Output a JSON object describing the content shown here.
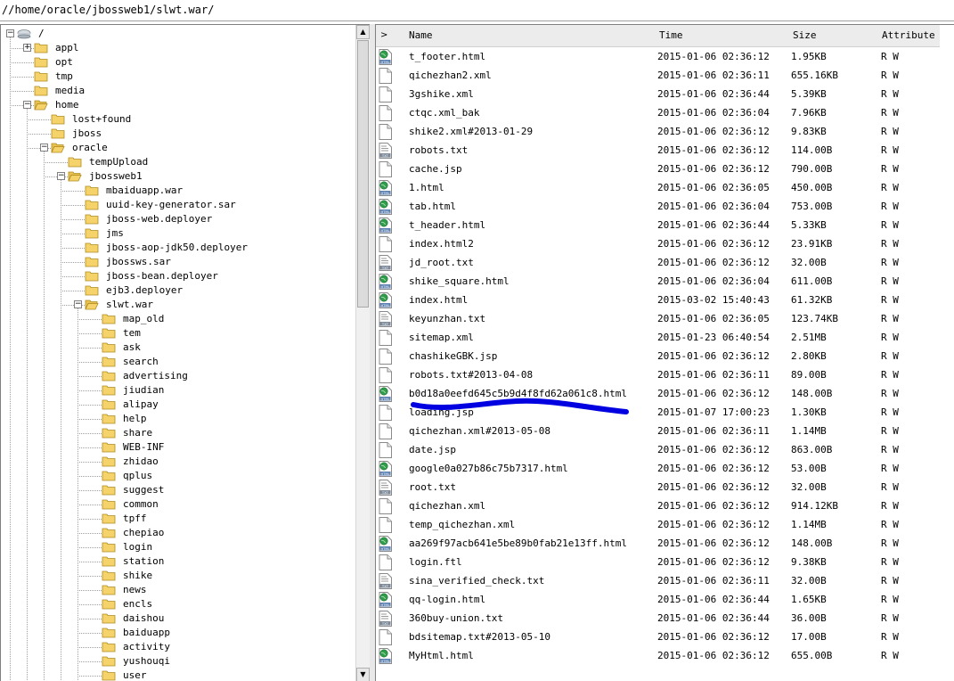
{
  "path": "//home/oracle/jbossweb1/slwt.war/",
  "tree": {
    "nodes": [
      {
        "label": "/",
        "depth": 0,
        "exp": "minus",
        "icon": "drive-icon"
      },
      {
        "label": "appl",
        "depth": 1,
        "exp": "plus",
        "icon": "folder-icon"
      },
      {
        "label": "opt",
        "depth": 1,
        "exp": "",
        "icon": "folder-icon"
      },
      {
        "label": "tmp",
        "depth": 1,
        "exp": "",
        "icon": "folder-icon"
      },
      {
        "label": "media",
        "depth": 1,
        "exp": "",
        "icon": "folder-icon"
      },
      {
        "label": "home",
        "depth": 1,
        "exp": "minus",
        "icon": "folder-open-icon"
      },
      {
        "label": "lost+found",
        "depth": 2,
        "exp": "",
        "icon": "folder-icon"
      },
      {
        "label": "jboss",
        "depth": 2,
        "exp": "",
        "icon": "folder-icon"
      },
      {
        "label": "oracle",
        "depth": 2,
        "exp": "minus",
        "icon": "folder-open-icon"
      },
      {
        "label": "tempUpload",
        "depth": 3,
        "exp": "",
        "icon": "folder-icon"
      },
      {
        "label": "jbossweb1",
        "depth": 3,
        "exp": "minus",
        "icon": "folder-open-icon"
      },
      {
        "label": "mbaiduapp.war",
        "depth": 4,
        "exp": "",
        "icon": "folder-icon"
      },
      {
        "label": "uuid-key-generator.sar",
        "depth": 4,
        "exp": "",
        "icon": "folder-icon"
      },
      {
        "label": "jboss-web.deployer",
        "depth": 4,
        "exp": "",
        "icon": "folder-icon"
      },
      {
        "label": "jms",
        "depth": 4,
        "exp": "",
        "icon": "folder-icon"
      },
      {
        "label": "jboss-aop-jdk50.deployer",
        "depth": 4,
        "exp": "",
        "icon": "folder-icon"
      },
      {
        "label": "jbossws.sar",
        "depth": 4,
        "exp": "",
        "icon": "folder-icon"
      },
      {
        "label": "jboss-bean.deployer",
        "depth": 4,
        "exp": "",
        "icon": "folder-icon"
      },
      {
        "label": "ejb3.deployer",
        "depth": 4,
        "exp": "",
        "icon": "folder-icon"
      },
      {
        "label": "slwt.war",
        "depth": 4,
        "exp": "minus",
        "icon": "folder-open-icon"
      },
      {
        "label": "map_old",
        "depth": 5,
        "exp": "",
        "icon": "folder-icon"
      },
      {
        "label": "tem",
        "depth": 5,
        "exp": "",
        "icon": "folder-icon"
      },
      {
        "label": "ask",
        "depth": 5,
        "exp": "",
        "icon": "folder-icon"
      },
      {
        "label": "search",
        "depth": 5,
        "exp": "",
        "icon": "folder-icon"
      },
      {
        "label": "advertising",
        "depth": 5,
        "exp": "",
        "icon": "folder-icon"
      },
      {
        "label": "jiudian",
        "depth": 5,
        "exp": "",
        "icon": "folder-icon"
      },
      {
        "label": "alipay",
        "depth": 5,
        "exp": "",
        "icon": "folder-icon"
      },
      {
        "label": "help",
        "depth": 5,
        "exp": "",
        "icon": "folder-icon"
      },
      {
        "label": "share",
        "depth": 5,
        "exp": "",
        "icon": "folder-icon"
      },
      {
        "label": "WEB-INF",
        "depth": 5,
        "exp": "",
        "icon": "folder-icon"
      },
      {
        "label": "zhidao",
        "depth": 5,
        "exp": "",
        "icon": "folder-icon"
      },
      {
        "label": "qplus",
        "depth": 5,
        "exp": "",
        "icon": "folder-icon"
      },
      {
        "label": "suggest",
        "depth": 5,
        "exp": "",
        "icon": "folder-icon"
      },
      {
        "label": "common",
        "depth": 5,
        "exp": "",
        "icon": "folder-icon"
      },
      {
        "label": "tpff",
        "depth": 5,
        "exp": "",
        "icon": "folder-icon"
      },
      {
        "label": "chepiao",
        "depth": 5,
        "exp": "",
        "icon": "folder-icon"
      },
      {
        "label": "login",
        "depth": 5,
        "exp": "",
        "icon": "folder-icon"
      },
      {
        "label": "station",
        "depth": 5,
        "exp": "",
        "icon": "folder-icon"
      },
      {
        "label": "shike",
        "depth": 5,
        "exp": "",
        "icon": "folder-icon"
      },
      {
        "label": "news",
        "depth": 5,
        "exp": "",
        "icon": "folder-icon"
      },
      {
        "label": "encls",
        "depth": 5,
        "exp": "",
        "icon": "folder-icon"
      },
      {
        "label": "daishou",
        "depth": 5,
        "exp": "",
        "icon": "folder-icon"
      },
      {
        "label": "baiduapp",
        "depth": 5,
        "exp": "",
        "icon": "folder-icon"
      },
      {
        "label": "activity",
        "depth": 5,
        "exp": "",
        "icon": "folder-icon"
      },
      {
        "label": "yushouqi",
        "depth": 5,
        "exp": "",
        "icon": "folder-icon"
      },
      {
        "label": "user",
        "depth": 5,
        "exp": "",
        "icon": "folder-icon"
      }
    ]
  },
  "list": {
    "header_icon": "chevron-right-icon",
    "columns": {
      "name": "Name",
      "time": "Time",
      "size": "Size",
      "attr": "Attribute"
    },
    "files": [
      {
        "name": "t_footer.html",
        "time": "2015-01-06 02:36:12",
        "size": "1.95KB",
        "attr": "R W",
        "icon": "html-file-icon"
      },
      {
        "name": "qichezhan2.xml",
        "time": "2015-01-06 02:36:11",
        "size": "655.16KB",
        "attr": "R W",
        "icon": "file-icon"
      },
      {
        "name": "3gshike.xml",
        "time": "2015-01-06 02:36:44",
        "size": "5.39KB",
        "attr": "R W",
        "icon": "file-icon"
      },
      {
        "name": "ctqc.xml_bak",
        "time": "2015-01-06 02:36:04",
        "size": "7.96KB",
        "attr": "R W",
        "icon": "file-icon"
      },
      {
        "name": "shike2.xml#2013-01-29",
        "time": "2015-01-06 02:36:12",
        "size": "9.83KB",
        "attr": "R W",
        "icon": "file-icon"
      },
      {
        "name": "robots.txt",
        "time": "2015-01-06 02:36:12",
        "size": "114.00B",
        "attr": "R W",
        "icon": "txt-file-icon"
      },
      {
        "name": "cache.jsp",
        "time": "2015-01-06 02:36:12",
        "size": "790.00B",
        "attr": "R W",
        "icon": "file-icon"
      },
      {
        "name": "1.html",
        "time": "2015-01-06 02:36:05",
        "size": "450.00B",
        "attr": "R W",
        "icon": "html-file-icon"
      },
      {
        "name": "tab.html",
        "time": "2015-01-06 02:36:04",
        "size": "753.00B",
        "attr": "R W",
        "icon": "html-file-icon"
      },
      {
        "name": "t_header.html",
        "time": "2015-01-06 02:36:44",
        "size": "5.33KB",
        "attr": "R W",
        "icon": "html-file-icon"
      },
      {
        "name": "index.html2",
        "time": "2015-01-06 02:36:12",
        "size": "23.91KB",
        "attr": "R W",
        "icon": "file-icon"
      },
      {
        "name": "jd_root.txt",
        "time": "2015-01-06 02:36:12",
        "size": "32.00B",
        "attr": "R W",
        "icon": "txt-file-icon"
      },
      {
        "name": "shike_square.html",
        "time": "2015-01-06 02:36:04",
        "size": "611.00B",
        "attr": "R W",
        "icon": "html-file-icon"
      },
      {
        "name": "index.html",
        "time": "2015-03-02 15:40:43",
        "size": "61.32KB",
        "attr": "R W",
        "icon": "html-file-icon"
      },
      {
        "name": "keyunzhan.txt",
        "time": "2015-01-06 02:36:05",
        "size": "123.74KB",
        "attr": "R W",
        "icon": "txt-file-icon"
      },
      {
        "name": "sitemap.xml",
        "time": "2015-01-23 06:40:54",
        "size": "2.51MB",
        "attr": "R W",
        "icon": "file-icon"
      },
      {
        "name": "chashikeGBK.jsp",
        "time": "2015-01-06 02:36:12",
        "size": "2.80KB",
        "attr": "R W",
        "icon": "file-icon"
      },
      {
        "name": "robots.txt#2013-04-08",
        "time": "2015-01-06 02:36:11",
        "size": "89.00B",
        "attr": "R W",
        "icon": "file-icon"
      },
      {
        "name": "b0d18a0eefd645c5b9d4f8fd62a061c8.html",
        "time": "2015-01-06 02:36:12",
        "size": "148.00B",
        "attr": "R W",
        "icon": "html-file-icon"
      },
      {
        "name": "loading.jsp",
        "time": "2015-01-07 17:00:23",
        "size": "1.30KB",
        "attr": "R W",
        "icon": "file-icon"
      },
      {
        "name": "qichezhan.xml#2013-05-08",
        "time": "2015-01-06 02:36:11",
        "size": "1.14MB",
        "attr": "R W",
        "icon": "file-icon"
      },
      {
        "name": "date.jsp",
        "time": "2015-01-06 02:36:12",
        "size": "863.00B",
        "attr": "R W",
        "icon": "file-icon"
      },
      {
        "name": "google0a027b86c75b7317.html",
        "time": "2015-01-06 02:36:12",
        "size": "53.00B",
        "attr": "R W",
        "icon": "html-file-icon"
      },
      {
        "name": "root.txt",
        "time": "2015-01-06 02:36:12",
        "size": "32.00B",
        "attr": "R W",
        "icon": "txt-file-icon"
      },
      {
        "name": "qichezhan.xml",
        "time": "2015-01-06 02:36:12",
        "size": "914.12KB",
        "attr": "R W",
        "icon": "file-icon"
      },
      {
        "name": "temp_qichezhan.xml",
        "time": "2015-01-06 02:36:12",
        "size": "1.14MB",
        "attr": "R W",
        "icon": "file-icon"
      },
      {
        "name": "aa269f97acb641e5be89b0fab21e13ff.html",
        "time": "2015-01-06 02:36:12",
        "size": "148.00B",
        "attr": "R W",
        "icon": "html-file-icon"
      },
      {
        "name": "login.ftl",
        "time": "2015-01-06 02:36:12",
        "size": "9.38KB",
        "attr": "R W",
        "icon": "file-icon"
      },
      {
        "name": "sina_verified_check.txt",
        "time": "2015-01-06 02:36:11",
        "size": "32.00B",
        "attr": "R W",
        "icon": "txt-file-icon"
      },
      {
        "name": "qq-login.html",
        "time": "2015-01-06 02:36:44",
        "size": "1.65KB",
        "attr": "R W",
        "icon": "html-file-icon"
      },
      {
        "name": "360buy-union.txt",
        "time": "2015-01-06 02:36:44",
        "size": "36.00B",
        "attr": "R W",
        "icon": "txt-file-icon"
      },
      {
        "name": "bdsitemap.txt#2013-05-10",
        "time": "2015-01-06 02:36:12",
        "size": "17.00B",
        "attr": "R W",
        "icon": "file-icon"
      },
      {
        "name": "MyHtml.html",
        "time": "2015-01-06 02:36:12",
        "size": "655.00B",
        "attr": "R W",
        "icon": "html-file-icon"
      }
    ]
  },
  "colors": {
    "annotation": "#0000e0",
    "folder": "#f5d36a",
    "html_globe": "#2e9e4a"
  }
}
